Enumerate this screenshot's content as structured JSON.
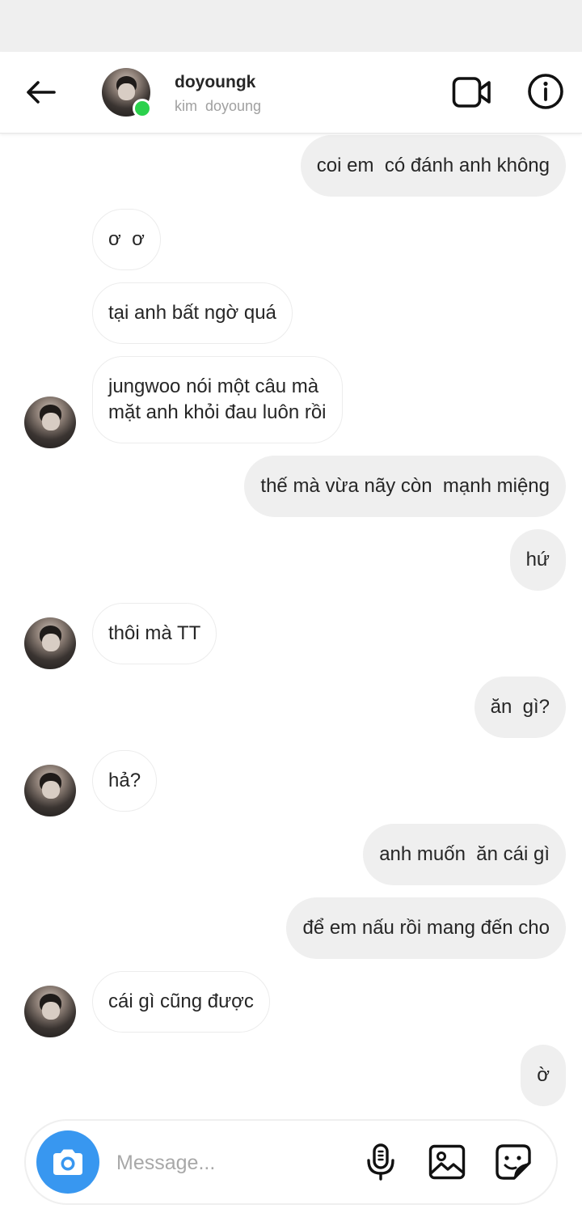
{
  "header": {
    "username": "doyoungk",
    "fullname": "kim  doyoung",
    "online": true
  },
  "messages": [
    {
      "side": "sent",
      "text": "coi em  có đánh anh không"
    },
    {
      "side": "received",
      "text": "ơ  ơ"
    },
    {
      "side": "received",
      "text": "tại anh bất ngờ quá"
    },
    {
      "side": "received",
      "text": "jungwoo nói một câu mà\nmặt anh khỏi đau luôn rồi"
    },
    {
      "side": "sent",
      "text": "thế mà vừa nãy còn  mạnh miệng"
    },
    {
      "side": "sent",
      "text": "hứ"
    },
    {
      "side": "received",
      "text": "thôi mà TT"
    },
    {
      "side": "sent",
      "text": "ăn  gì?"
    },
    {
      "side": "received",
      "text": "hả?"
    },
    {
      "side": "sent",
      "text": "anh muốn  ăn cái gì"
    },
    {
      "side": "sent",
      "text": "để em nấu rồi mang đến cho"
    },
    {
      "side": "received",
      "text": "cái gì cũng được"
    },
    {
      "side": "sent",
      "text": "ờ"
    }
  ],
  "composer": {
    "placeholder": "Message..."
  },
  "icons": {
    "back": "arrow-left-icon",
    "video": "video-camera-icon",
    "info": "info-icon",
    "camera": "camera-icon",
    "microphone": "microphone-icon",
    "gallery": "image-icon",
    "sticker": "sticker-icon"
  },
  "colors": {
    "sent_bubble": "#efefef",
    "received_border": "#ececec",
    "online": "#2bd14c",
    "camera_button": "#3897f0",
    "placeholder": "#a8a8a8",
    "status_bar": "#efefef"
  }
}
